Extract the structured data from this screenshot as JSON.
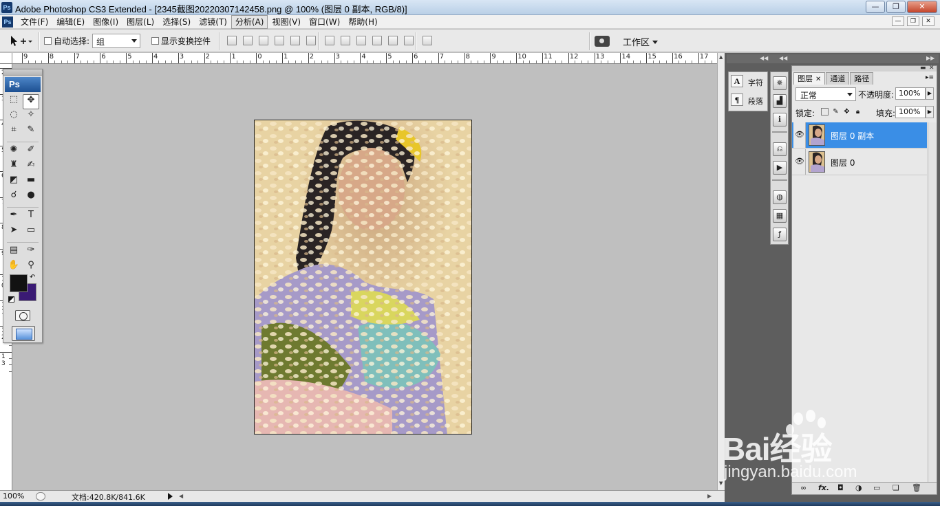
{
  "window": {
    "title": "Adobe Photoshop CS3 Extended - [2345截图20220307142458.png @ 100% (图层 0 副本, RGB/8)]",
    "logo": "Ps",
    "min": "—",
    "max": "❐",
    "close": "✕"
  },
  "menubar": {
    "logo": "Ps",
    "items": [
      "文件(F)",
      "编辑(E)",
      "图像(I)",
      "图层(L)",
      "选择(S)",
      "滤镜(T)",
      "分析(A)",
      "视图(V)",
      "窗口(W)",
      "帮助(H)"
    ],
    "active_index": 6,
    "mdi": {
      "min": "—",
      "restore": "❐",
      "close": "✕"
    }
  },
  "options": {
    "tool_icon": "move-tool-icon",
    "auto_select_label": "自动选择:",
    "auto_select_checked": false,
    "auto_select_value": "组",
    "show_transform_label": "显示变换控件",
    "show_transform_checked": false,
    "workspace_label": "工作区"
  },
  "ruler": {
    "h_labels": [
      "9",
      "8",
      "7",
      "6",
      "5",
      "4",
      "3",
      "2",
      "1",
      "0",
      "1",
      "2",
      "3",
      "4",
      "5",
      "6",
      "7",
      "8",
      "9",
      "10",
      "11",
      "12",
      "13",
      "14",
      "15",
      "16",
      "17"
    ],
    "v_labels": [
      "2",
      "3",
      "4",
      "5",
      "6",
      "7",
      "8",
      "9",
      "1\n0",
      "1\n1",
      "1\n2",
      "1\n3"
    ]
  },
  "toolbox": {
    "logo": "Ps",
    "tools": [
      {
        "name": "marquee-tool",
        "glyph": "⬚"
      },
      {
        "name": "move-tool",
        "glyph": "✥",
        "active": true
      },
      {
        "name": "lasso-tool",
        "glyph": "◌"
      },
      {
        "name": "magic-wand-tool",
        "glyph": "✧"
      },
      {
        "name": "crop-tool",
        "glyph": "⌗"
      },
      {
        "name": "slice-tool",
        "glyph": "✎"
      },
      {
        "name": "sep"
      },
      {
        "name": "healing-brush-tool",
        "glyph": "✺"
      },
      {
        "name": "brush-tool",
        "glyph": "✐"
      },
      {
        "name": "clone-stamp-tool",
        "glyph": "♜"
      },
      {
        "name": "history-brush-tool",
        "glyph": "✍"
      },
      {
        "name": "eraser-tool",
        "glyph": "◩"
      },
      {
        "name": "gradient-tool",
        "glyph": "▬"
      },
      {
        "name": "blur-tool",
        "glyph": "☌"
      },
      {
        "name": "dodge-tool",
        "glyph": "●"
      },
      {
        "name": "sep"
      },
      {
        "name": "pen-tool",
        "glyph": "✒"
      },
      {
        "name": "type-tool",
        "glyph": "T"
      },
      {
        "name": "path-selection-tool",
        "glyph": "➤"
      },
      {
        "name": "shape-tool",
        "glyph": "▭"
      },
      {
        "name": "sep"
      },
      {
        "name": "notes-tool",
        "glyph": "▤"
      },
      {
        "name": "eyedropper-tool",
        "glyph": "✑"
      },
      {
        "name": "hand-tool",
        "glyph": "✋"
      },
      {
        "name": "zoom-tool",
        "glyph": "⚲"
      }
    ],
    "foreground_color": "#121212",
    "background_color": "#3a1a74"
  },
  "status": {
    "zoom": "100%",
    "doc": "文档:420.8K/841.6K"
  },
  "dock": {
    "char_panel": {
      "char_label": "字符",
      "para_label": "段落",
      "char_icon": "A",
      "para_icon": "¶"
    },
    "strip_icons": [
      "navigator-icon",
      "histogram-icon",
      "info-icon",
      "history-icon",
      "actions-icon",
      "color-icon",
      "swatches-icon",
      "styles-icon"
    ]
  },
  "layers_panel": {
    "tabs": [
      "图层",
      "通道",
      "路径"
    ],
    "active_tab": 0,
    "blend_mode": "正常",
    "opacity_label": "不透明度:",
    "opacity_value": "100%",
    "lock_label": "锁定:",
    "fill_label": "填充:",
    "fill_value": "100%",
    "layers": [
      {
        "name": "图层 0 副本",
        "visible": true,
        "selected": true
      },
      {
        "name": "图层 0",
        "visible": true,
        "selected": false
      }
    ],
    "bottom_icons": [
      "link-icon",
      "fx-icon",
      "mask-icon",
      "adjustment-icon",
      "group-icon",
      "new-layer-icon",
      "delete-icon"
    ]
  },
  "watermark": {
    "logo": "Bai经验",
    "url": "jingyan.baidu.com"
  }
}
